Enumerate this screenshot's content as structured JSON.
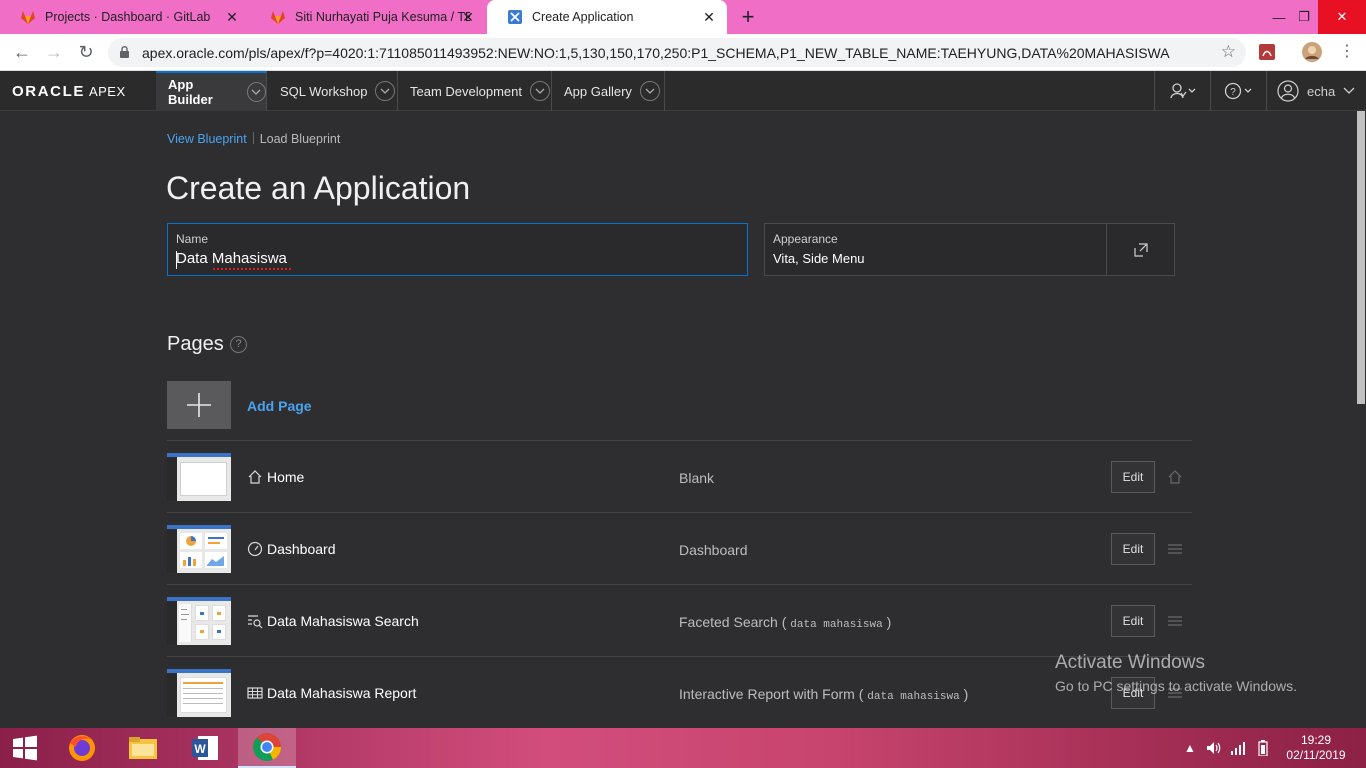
{
  "browser": {
    "tabs": [
      {
        "label": "Projects · Dashboard · GitLab",
        "icon": "gitlab-icon"
      },
      {
        "label": "Siti Nurhayati Puja Kesuma / TB D",
        "icon": "gitlab-icon"
      },
      {
        "label": "Create Application",
        "icon": "apex-icon",
        "active": true
      }
    ],
    "url": "apex.oracle.com/pls/apex/f?p=4020:1:711085011493952:NEW:NO:1,5,130,150,170,250:P1_SCHEMA,P1_NEW_TABLE_NAME:TAEHYUNG,DATA%20MAHASISWA"
  },
  "apex_header": {
    "logo": "ORACLE",
    "logo_suffix": "APEX",
    "nav": [
      "App Builder",
      "SQL Workshop",
      "Team Development",
      "App Gallery"
    ],
    "user": "echa"
  },
  "breadcrumb": {
    "view": "View Blueprint",
    "load": "Load Blueprint"
  },
  "page_title": "Create an Application",
  "name_field": {
    "label": "Name",
    "value": "Data Mahasiswa"
  },
  "appearance_field": {
    "label": "Appearance",
    "value": "Vita, Side Menu"
  },
  "pages": {
    "heading": "Pages",
    "add_label": "Add Page",
    "rows": [
      {
        "name": "Home",
        "type": "Blank",
        "source": "",
        "edit": "Edit",
        "icon": "home-icon"
      },
      {
        "name": "Dashboard",
        "type": "Dashboard",
        "source": "",
        "edit": "Edit",
        "icon": "dashboard-icon"
      },
      {
        "name": "Data Mahasiswa Search",
        "type": "Faceted Search",
        "source": "data mahasiswa",
        "edit": "Edit",
        "icon": "search-list-icon"
      },
      {
        "name": "Data Mahasiswa Report",
        "type": "Interactive Report with Form",
        "source": "data mahasiswa",
        "edit": "Edit",
        "icon": "table-icon"
      }
    ]
  },
  "watermark": {
    "line1": "Activate Windows",
    "line2": "Go to PC settings to activate Windows."
  },
  "taskbar": {
    "time": "19:29",
    "date": "02/11/2019"
  }
}
